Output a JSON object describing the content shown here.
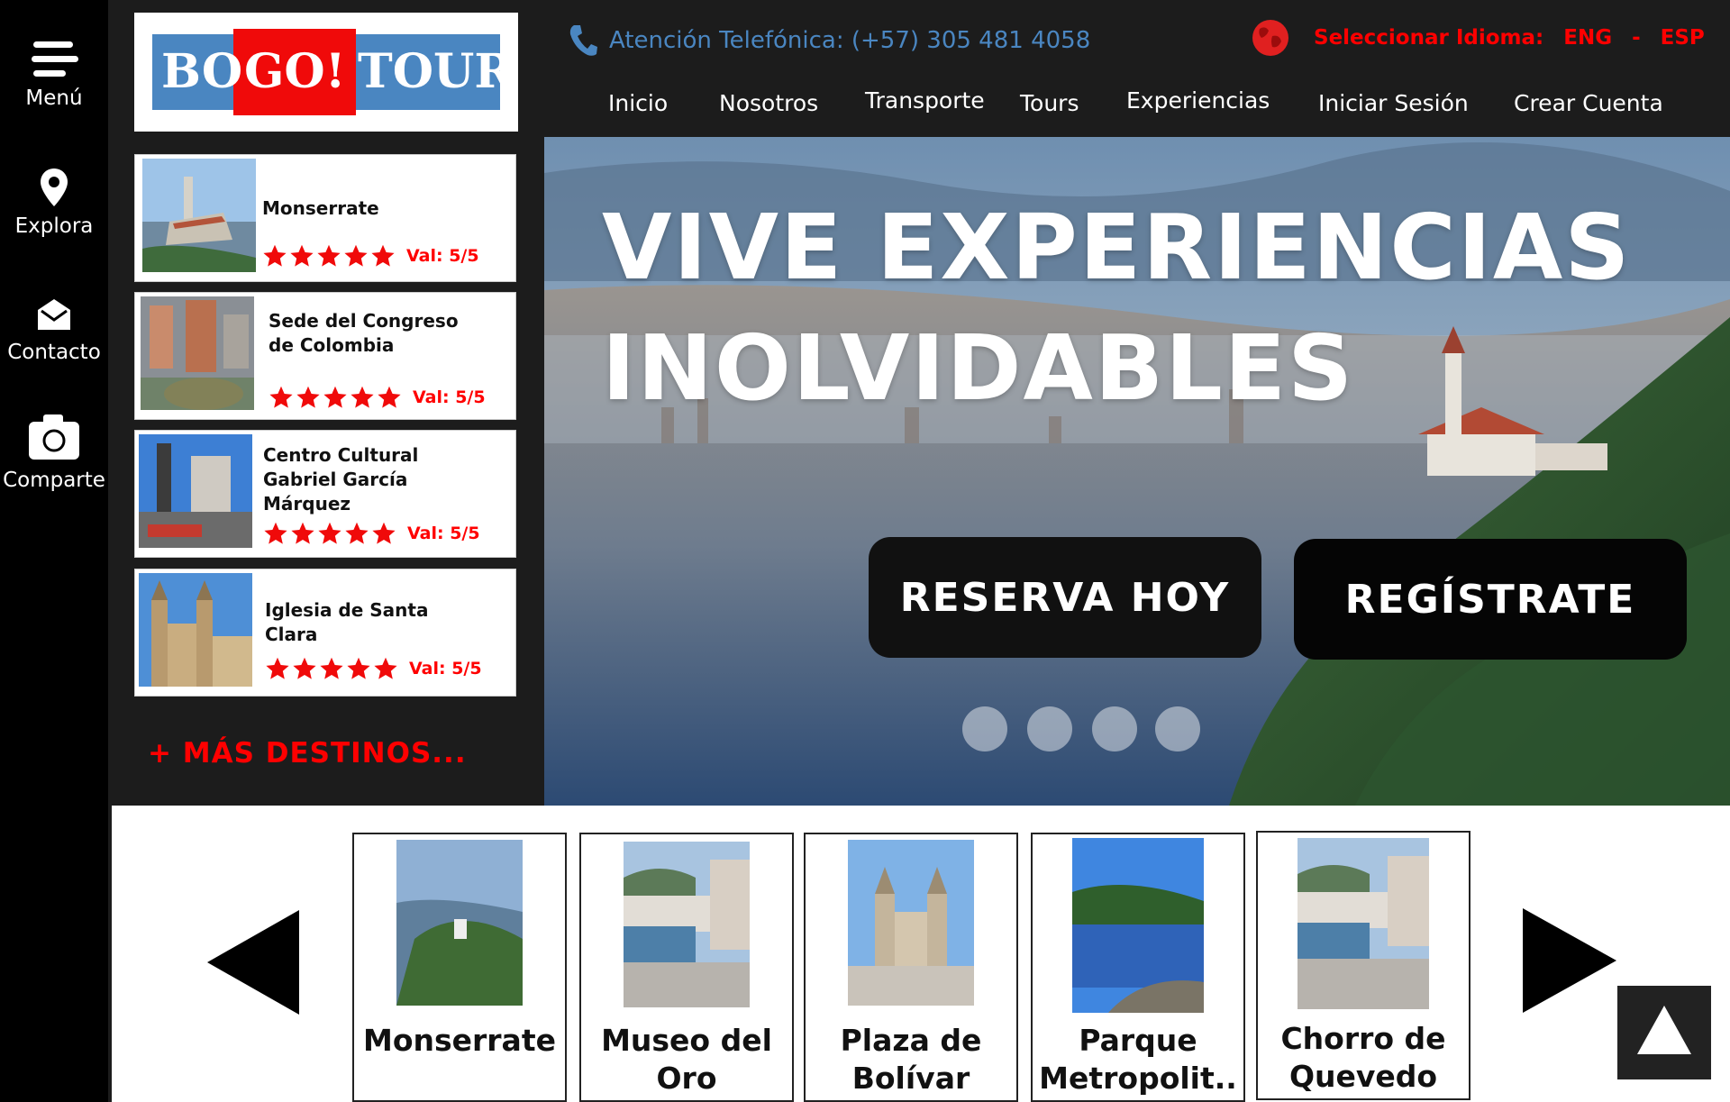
{
  "rail": {
    "items": [
      {
        "label": "Menú",
        "icon": "menu-icon"
      },
      {
        "label": "Explora",
        "icon": "location-pin-icon"
      },
      {
        "label": "Contacto",
        "icon": "mail-icon"
      },
      {
        "label": "Comparte",
        "icon": "camera-icon"
      }
    ]
  },
  "logo": {
    "part1": "BO",
    "part2": "GO!",
    "part3": "TOUR"
  },
  "header": {
    "phone_text": "Atención Telefónica: (+57) 305 481 4058",
    "language_label": "Seleccionar Idioma:",
    "lang_eng": "ENG",
    "lang_sep": "-",
    "lang_esp": "ESP"
  },
  "nav": {
    "items": [
      "Inicio",
      "Nosotros",
      "Transporte",
      "Tours",
      "Experiencias",
      "Iniciar Sesión",
      "Crear Cuenta"
    ]
  },
  "destinations": [
    {
      "name_lines": [
        "Monserrate"
      ],
      "rating_text": "Val: 5/5",
      "stars": 5
    },
    {
      "name_lines": [
        "Sede del Congreso",
        "de Colombia"
      ],
      "rating_text": "Val: 5/5",
      "stars": 5
    },
    {
      "name_lines": [
        "Centro Cultural",
        "Gabriel García",
        "Márquez"
      ],
      "rating_text": "Val: 5/5",
      "stars": 5
    },
    {
      "name_lines": [
        "Iglesia de Santa",
        "Clara"
      ],
      "rating_text": "Val: 5/5",
      "stars": 5
    }
  ],
  "more_link": "+ MÁS DESTINOS...",
  "hero": {
    "line1": "VIVE EXPERIENCIAS",
    "line2": "INOLVIDABLES",
    "btn_reserve": "RESERVA HOY",
    "btn_register": "REGÍSTRATE",
    "slide_count": 4
  },
  "carousel": {
    "tiles": [
      {
        "line1": "Monserrate",
        "line2": ""
      },
      {
        "line1": "Museo del",
        "line2": "Oro"
      },
      {
        "line1": "Plaza de",
        "line2": "Bolívar"
      },
      {
        "line1": "Parque",
        "line2": "Metropolit.."
      },
      {
        "line1": "Chorro de",
        "line2": "Quevedo"
      }
    ]
  },
  "colors": {
    "accent_red": "#f00a0a",
    "brand_blue": "#4a86c1",
    "panel_dark": "#1c1c1c"
  }
}
